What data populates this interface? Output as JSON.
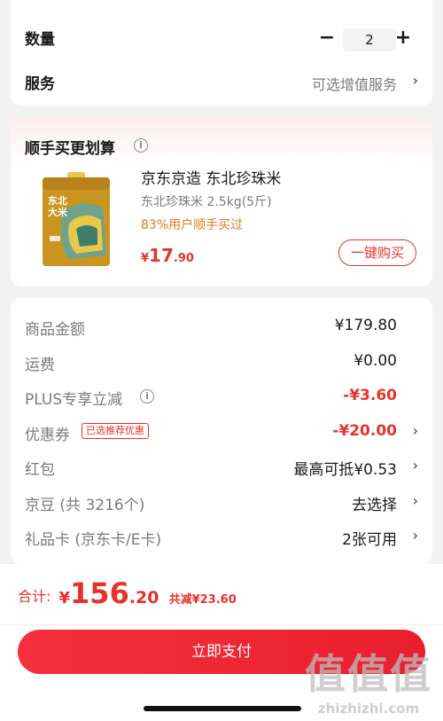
{
  "quantity": {
    "label": "数量",
    "value": "2",
    "minus": "−",
    "plus": "+"
  },
  "service": {
    "label": "服务",
    "value": "可选增值服务"
  },
  "bundle": {
    "title": "顺手买更划算",
    "product_name": "京东京造 东北珍珠米",
    "product_spec": "东北珍珠米 2.5kg(5斤)",
    "product_hint": "83%用户顺手买过",
    "price_symbol": "¥",
    "price_int": "17",
    "price_dec": ".90",
    "buy_label": "一键购买",
    "package_text": "东北大米"
  },
  "summary": {
    "rows": [
      {
        "label": "商品金额",
        "value": "¥179.80"
      },
      {
        "label": "运费",
        "value": "¥0.00"
      },
      {
        "label": "PLUS专享立减",
        "value": "-¥3.60"
      },
      {
        "label": "优惠券",
        "value": "-¥20.00",
        "badge": "已选推荐优惠"
      },
      {
        "label": "红包",
        "value": "最高可抵¥0.53"
      },
      {
        "label": "京豆 (共 3216个)",
        "value": "去选择"
      },
      {
        "label": "礼品卡 (京东卡/E卡)",
        "value": "2张可用"
      }
    ]
  },
  "footer": {
    "total_label": "合计:",
    "total_symbol": "¥",
    "total_int": "156",
    "total_dec": ".20",
    "discount": "共减¥23.60",
    "pay_label": "立即支付"
  },
  "watermark": {
    "big": "值值值",
    "small": "zhizhizhi.com"
  },
  "colors": {
    "accent_red": "#e5332a",
    "hint_orange": "#e07a1f"
  }
}
